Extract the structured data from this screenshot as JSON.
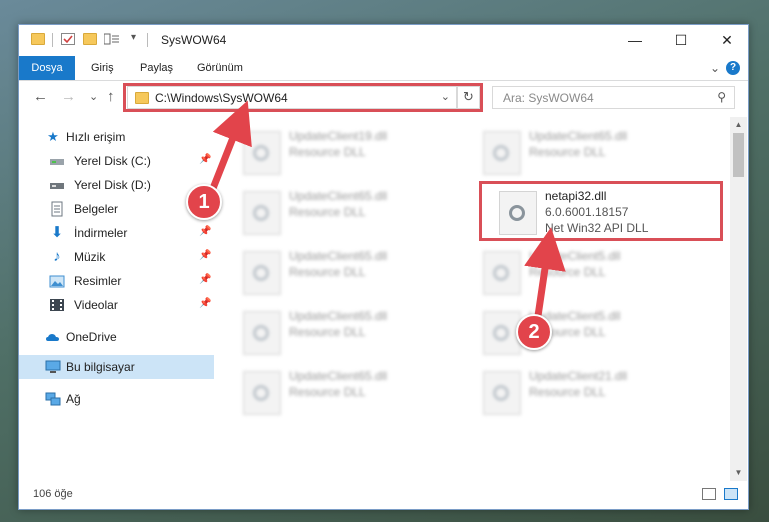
{
  "titlebar": {
    "title": "SysWOW64",
    "qat_dropdown": "▾",
    "minimize": "—",
    "maximize": "☐",
    "close": "✕"
  },
  "ribbon": {
    "tabs": [
      {
        "label": "Dosya"
      },
      {
        "label": "Giriş"
      },
      {
        "label": "Paylaş"
      },
      {
        "label": "Görünüm"
      }
    ],
    "collapse": "⌄",
    "help": "?"
  },
  "nav": {
    "back": "←",
    "forward": "→",
    "recent": "⌄",
    "up": "↑",
    "address": "C:\\Windows\\SysWOW64",
    "address_dropdown": "⌄",
    "refresh": "↻",
    "search_placeholder": "Ara: SysWOW64",
    "search_icon": "⚲"
  },
  "sidebar": {
    "items": [
      {
        "label": "Hızlı erişim",
        "icon": "star-icon"
      },
      {
        "label": "Yerel Disk (C:)",
        "icon": "drive-icon",
        "pinned": true
      },
      {
        "label": "Yerel Disk (D:)",
        "icon": "drive-icon",
        "pinned": false
      },
      {
        "label": "Belgeler",
        "icon": "documents-icon",
        "pinned": true
      },
      {
        "label": "İndirmeler",
        "icon": "download-icon",
        "pinned": true
      },
      {
        "label": "Müzik",
        "icon": "music-icon",
        "pinned": true
      },
      {
        "label": "Resimler",
        "icon": "pictures-icon",
        "pinned": true
      },
      {
        "label": "Videolar",
        "icon": "video-icon",
        "pinned": true
      },
      {
        "label": "OneDrive",
        "icon": "cloud-icon"
      },
      {
        "label": "Bu bilgisayar",
        "icon": "computer-icon",
        "selected": true
      },
      {
        "label": "Ağ",
        "icon": "network-icon"
      }
    ]
  },
  "files": [
    {
      "name": "UpdateClient19.dll",
      "desc": "Resource DLL"
    },
    {
      "name": "UpdateClient65.dll",
      "desc": "Resource DLL"
    },
    {
      "name": "UpdateClient65.dll",
      "desc": "Resource DLL"
    },
    {
      "name": "netapi32.dll",
      "version": "6.0.6001.18157",
      "desc": "Net Win32 API DLL"
    },
    {
      "name": "UpdateClient65.dll",
      "desc": "Resource DLL"
    },
    {
      "name": "UpdateClient5.dll",
      "desc": "Resource DLL"
    },
    {
      "name": "UpdateClient65.dll",
      "desc": "Resource DLL"
    },
    {
      "name": "UpdateClient5.dll",
      "desc": "Resource DLL"
    },
    {
      "name": "UpdateClient65.dll",
      "desc": "Resource DLL"
    },
    {
      "name": "UpdateClient21.dll",
      "desc": "Resource DLL"
    }
  ],
  "status": {
    "count": "106 öğe"
  },
  "scrollbar": {
    "up": "▲",
    "down": "▼"
  },
  "annotations": {
    "step1": "1",
    "step2": "2"
  },
  "colors": {
    "accent": "#1979ca",
    "highlight": "#d94f57",
    "marker": "#e2444b",
    "selected": "#cce4f7"
  }
}
